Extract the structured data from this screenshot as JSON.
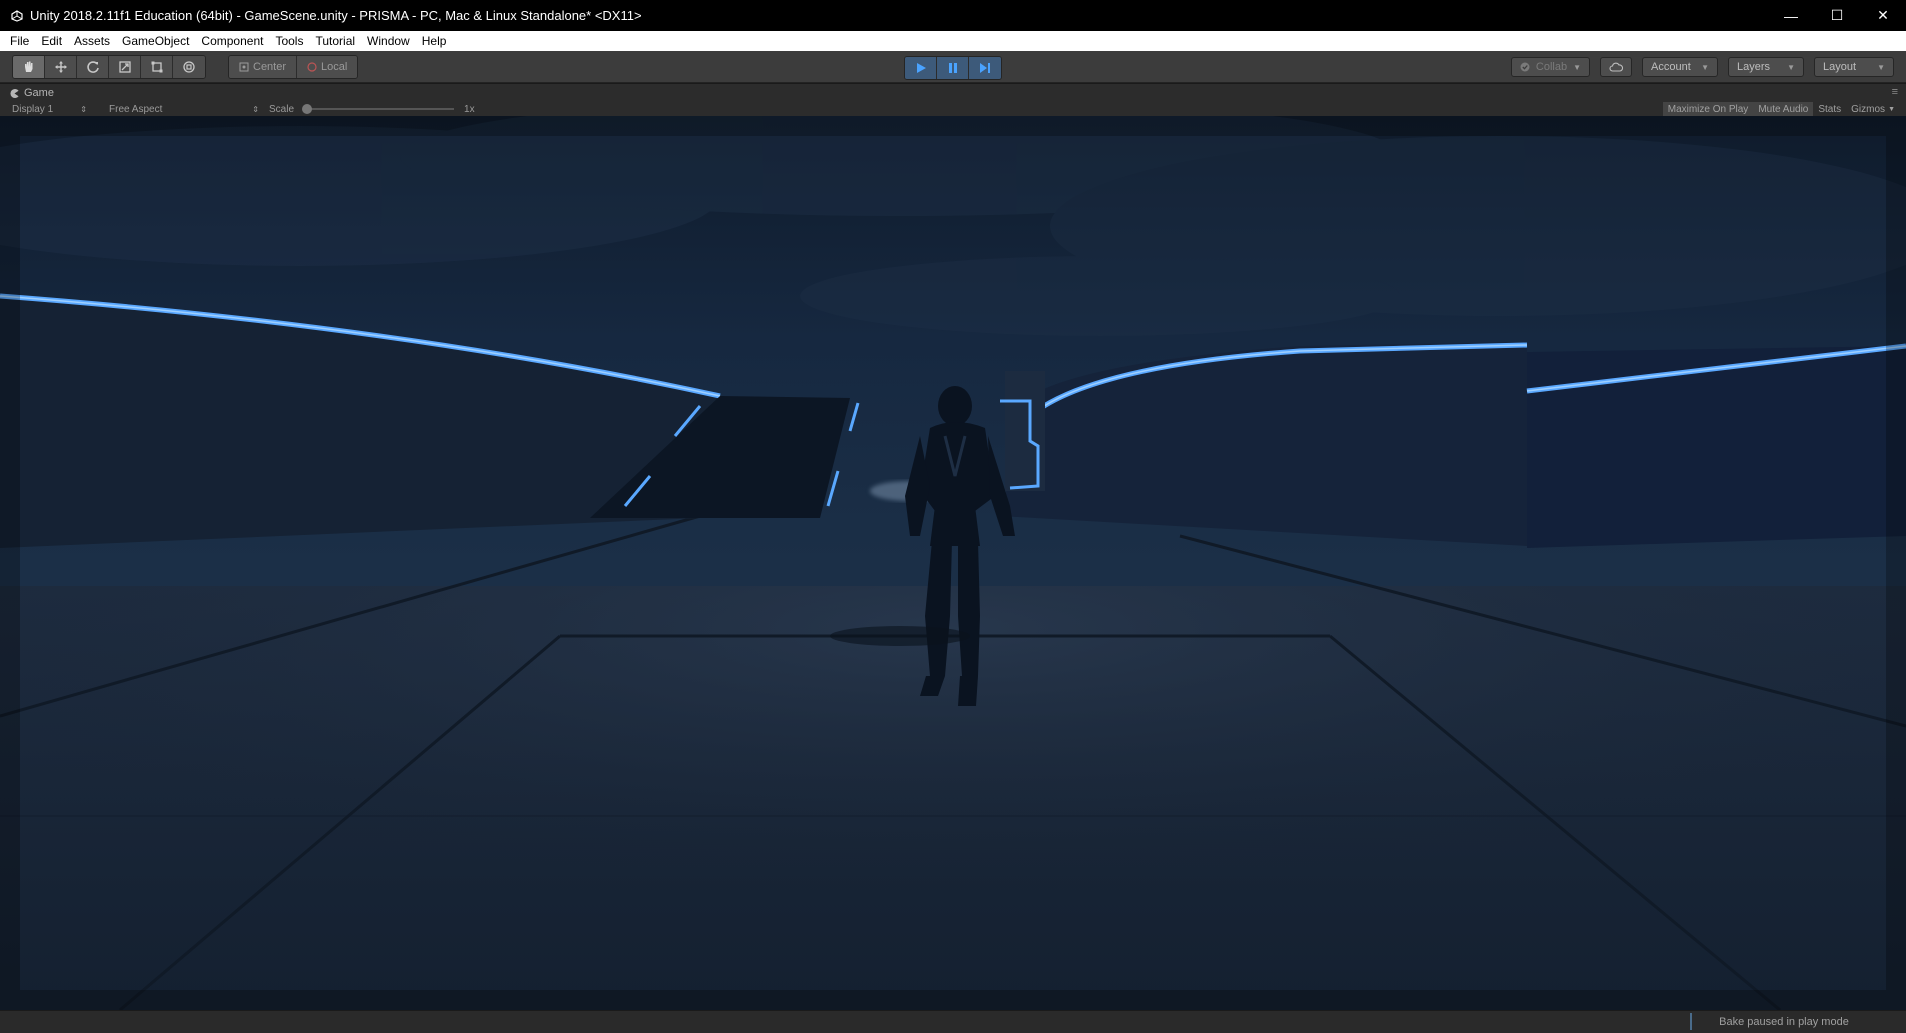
{
  "window": {
    "title": "Unity 2018.2.11f1 Education (64bit) - GameScene.unity - PRISMA - PC, Mac & Linux Standalone* <DX11>",
    "minimize": "—",
    "maximize": "☐",
    "close": "✕"
  },
  "menu": [
    "File",
    "Edit",
    "Assets",
    "GameObject",
    "Component",
    "Tools",
    "Tutorial",
    "Window",
    "Help"
  ],
  "toolbar": {
    "transform_tools": [
      "hand-tool",
      "move-tool",
      "rotate-tool",
      "scale-tool",
      "rect-tool",
      "transform-tool"
    ],
    "pivot_label": "Center",
    "rotation_label": "Local",
    "play_state": "playing",
    "collab_label": "Collab",
    "account_label": "Account",
    "layers_label": "Layers",
    "layout_label": "Layout"
  },
  "game_tab": {
    "tab_label": "Game",
    "display": "Display 1",
    "aspect": "Free Aspect",
    "scale_label": "Scale",
    "scale_value": "1x",
    "maximize_on_play": "Maximize On Play",
    "mute_audio": "Mute Audio",
    "stats": "Stats",
    "gizmos": "Gizmos"
  },
  "status": {
    "message": "Bake paused in play mode"
  },
  "colors": {
    "neon": "#5aa8ff",
    "sky": "#142438",
    "ground": "#1a2636",
    "play_active": "#3d5a7a"
  }
}
